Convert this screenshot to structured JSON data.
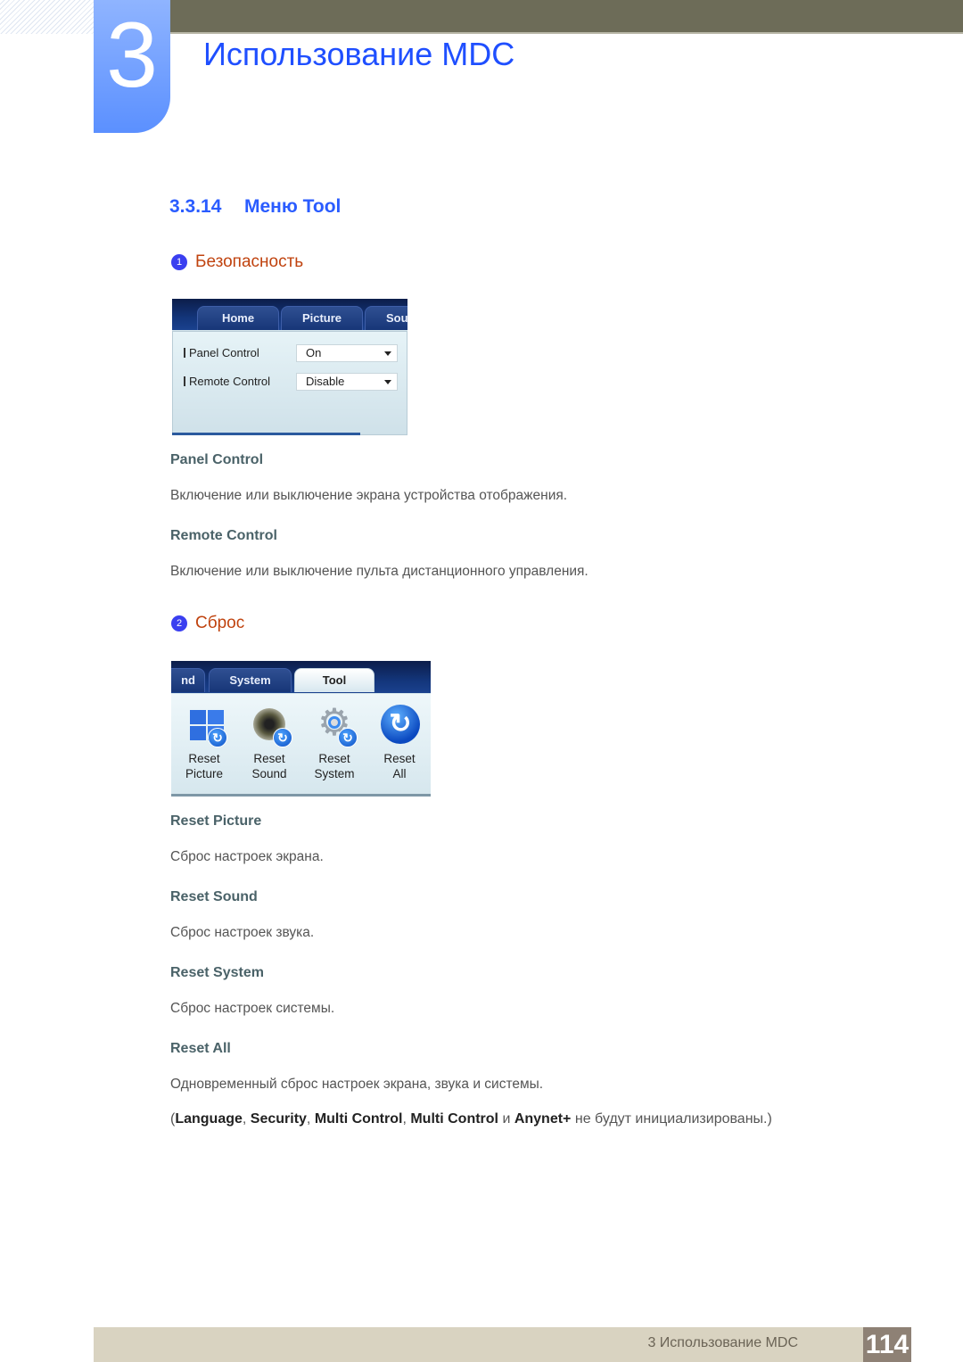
{
  "chapter": {
    "number": "3",
    "title": "Использование MDC"
  },
  "section": {
    "number": "3.3.14",
    "title": "Меню Tool"
  },
  "subsections": [
    {
      "badge": "1",
      "title": "Безопасность",
      "screenshot": {
        "tabs": [
          "Home",
          "Picture",
          "Sou"
        ],
        "rows": [
          {
            "label": "Panel Control",
            "value": "On"
          },
          {
            "label": "Remote Control",
            "value": "Disable"
          }
        ]
      },
      "items": [
        {
          "label": "Panel Control",
          "desc": "Включение или выключение экрана устройства отображения."
        },
        {
          "label": "Remote Control",
          "desc": "Включение или выключение пульта дистанционного управления."
        }
      ]
    },
    {
      "badge": "2",
      "title": "Сброс",
      "screenshot": {
        "tabs": [
          "nd",
          "System",
          "Tool"
        ],
        "buttons": [
          {
            "line1": "Reset",
            "line2": "Picture",
            "icon": "windows-refresh-icon"
          },
          {
            "line1": "Reset",
            "line2": "Sound",
            "icon": "speaker-refresh-icon"
          },
          {
            "line1": "Reset",
            "line2": "System",
            "icon": "gear-refresh-icon"
          },
          {
            "line1": "Reset",
            "line2": "All",
            "icon": "refresh-all-icon"
          }
        ]
      },
      "items": [
        {
          "label": "Reset Picture",
          "desc": "Сброс настроек экрана."
        },
        {
          "label": "Reset Sound",
          "desc": "Сброс настроек звука."
        },
        {
          "label": "Reset System",
          "desc": "Сброс настроек системы."
        },
        {
          "label": "Reset All",
          "desc": "Одновременный сброс настроек экрана, звука и системы."
        }
      ],
      "note": {
        "open": "(",
        "terms": [
          "Language",
          "Security",
          "Multi Control",
          "Multi Control"
        ],
        "and": "и",
        "last_term": "Anynet+",
        "tail": "не будут инициализированы.)"
      }
    }
  ],
  "footer": {
    "text": "3 Использование MDC",
    "page": "114"
  },
  "colors": {
    "chapter_blue": "#1f4fff",
    "subhead_orange": "#c0430f",
    "label_slate": "#4a6268",
    "top_bar": "#6d6c58",
    "footer_bg": "#d9d3c1",
    "page_box": "#8e8175"
  }
}
